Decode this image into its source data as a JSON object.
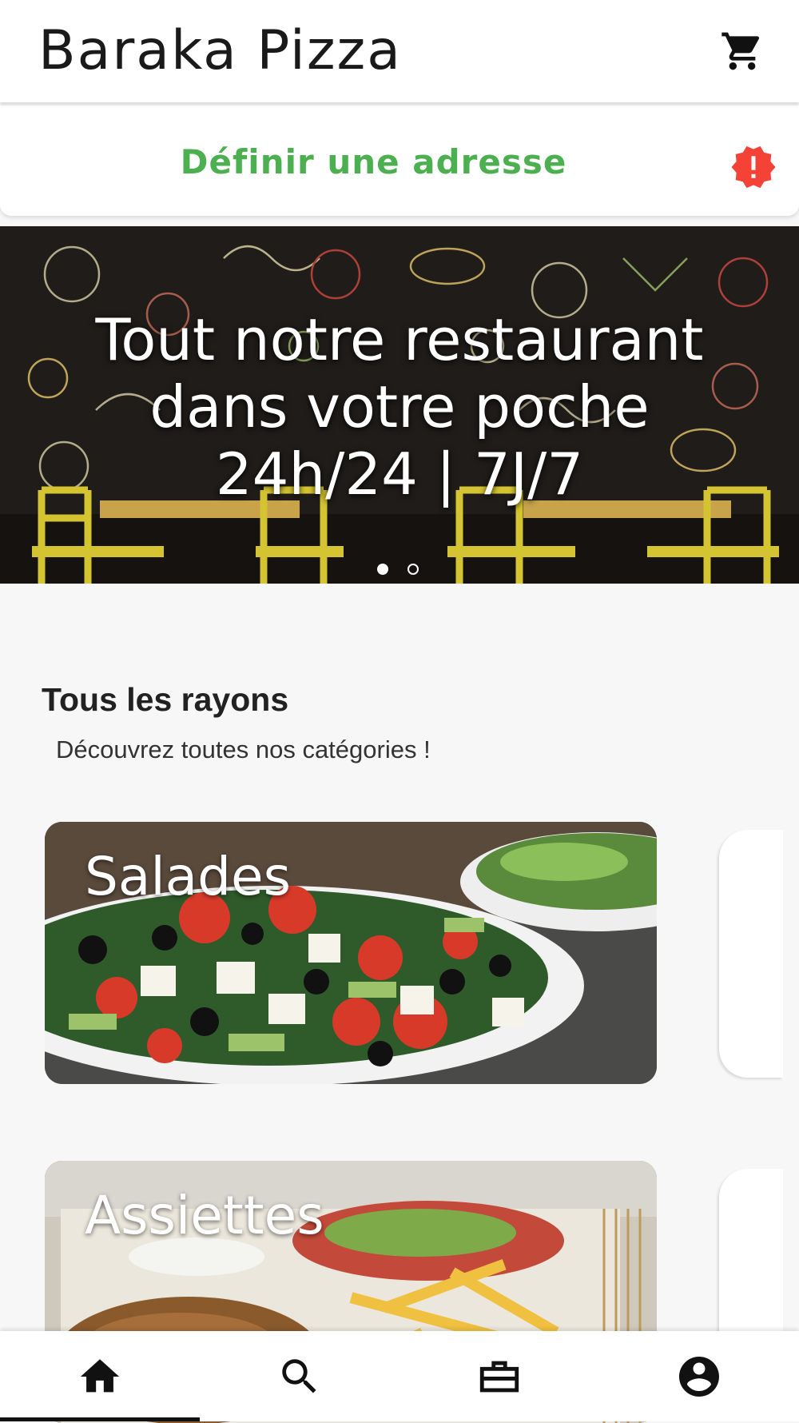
{
  "app": {
    "title": "Baraka Pizza",
    "cart_icon": "cart-icon"
  },
  "address": {
    "label": "Définir une adresse",
    "alert_icon": "alert-badge-icon",
    "label_color": "#4caf50",
    "alert_color": "#f44336"
  },
  "banner": {
    "line1": "Tout notre restaurant",
    "line2": "dans votre poche",
    "line3": "24h/24 | 7J/7",
    "slide_count": 2,
    "active_slide": 1
  },
  "section": {
    "title": "Tous les rayons",
    "subtitle": "Découvrez toutes nos catégories !"
  },
  "categories": [
    {
      "label": "Salades"
    },
    {
      "label": "Assiettes"
    }
  ],
  "bottom_nav": {
    "items": [
      {
        "icon": "home-icon",
        "active": true
      },
      {
        "icon": "search-icon",
        "active": false
      },
      {
        "icon": "briefcase-icon",
        "active": false
      },
      {
        "icon": "account-icon",
        "active": false
      }
    ]
  }
}
